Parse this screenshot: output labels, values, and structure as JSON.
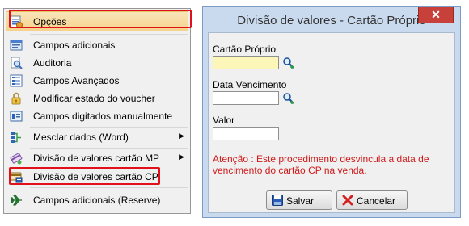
{
  "menu": {
    "items": [
      {
        "label": "Opções",
        "icon": "options-icon",
        "selected": true
      },
      {
        "label": "Campos adicionais",
        "icon": "extra-fields-icon"
      },
      {
        "label": "Auditoria",
        "icon": "audit-icon"
      },
      {
        "label": "Campos Avançados",
        "icon": "advanced-fields-icon"
      },
      {
        "label": "Modificar estado do voucher",
        "icon": "lock-icon"
      },
      {
        "label": "Campos digitados manualmente",
        "icon": "manual-fields-icon"
      },
      {
        "label": "Mesclar dados (Word)",
        "icon": "merge-icon",
        "submenu": true
      },
      {
        "label": "Divisão de valores cartão MP",
        "icon": "card-split-icon",
        "submenu": true
      },
      {
        "label": "Divisão de valores cartão CP",
        "icon": "card-cp-icon",
        "highlighted": true
      },
      {
        "label": "Campos adicionais (Reserve)",
        "icon": "plane-icon"
      }
    ]
  },
  "dialog": {
    "title": "Divisão de valores - Cartão Próprio",
    "close_label": "✕",
    "fields": {
      "cartao_label": "Cartão Próprio",
      "cartao_value": "",
      "vencimento_label": "Data Vencimento",
      "vencimento_value": "",
      "valor_label": "Valor",
      "valor_value": ""
    },
    "warning": "Atenção : Este procedimento desvincula a data de vencimento do cartão CP na venda.",
    "buttons": {
      "save_label": "Salvar",
      "cancel_label": "Cancelar"
    }
  },
  "colors": {
    "highlight_border": "#e0111b",
    "warning_text": "#d01b1b",
    "required_field": "#fcf7b8",
    "dialog_frame": "#c9d9ee",
    "close_button": "#c7403a"
  }
}
